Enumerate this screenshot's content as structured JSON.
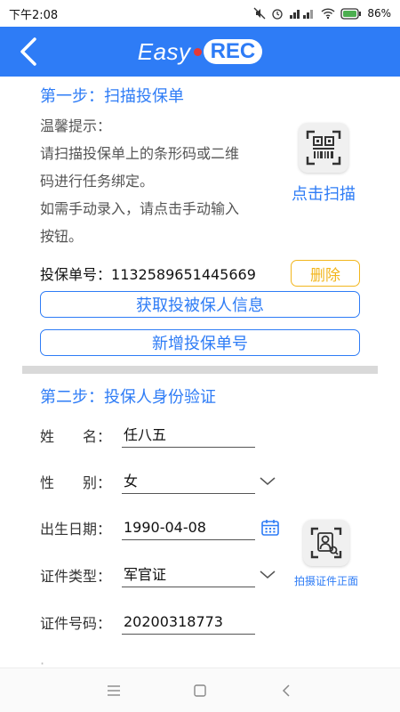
{
  "status_bar": {
    "time": "下午2:08",
    "battery": "86%"
  },
  "header": {
    "logo_left": "Easy",
    "logo_right": "REC"
  },
  "step1": {
    "title": "第一步：扫描投保单",
    "hint_lines": [
      "温馨提示：",
      "请扫描投保单上的条形码或二维",
      "码进行任务绑定。",
      "如需手动录入，请点击手动输入",
      "按钮。"
    ],
    "scan_label": "点击扫描",
    "policy_label": "投保单号：",
    "policy_number": "1132589651445669",
    "delete_label": "删除",
    "get_info_label": "获取投被保人信息",
    "add_policy_label": "新增投保单号"
  },
  "step2": {
    "title": "第二步：投保人身份验证",
    "fields": [
      {
        "label": "姓　　名：",
        "value": "任八五"
      },
      {
        "label": "性　　别：",
        "value": "女"
      },
      {
        "label": "出生日期：",
        "value": "1990-04-08"
      },
      {
        "label": "证件类型：",
        "value": "军官证"
      },
      {
        "label": "证件号码：",
        "value": "20200318773"
      }
    ],
    "id_photo_label": "拍摄证件正面"
  },
  "icons": {
    "back": "back-arrow-icon",
    "scan": "qr-scan-icon",
    "calendar": "calendar-icon",
    "dropdown": "chevron-down-icon",
    "id_photo": "id-card-person-icon"
  },
  "colors": {
    "primary": "#2e7cf6",
    "warning": "#f2b61d",
    "divider": "#d9d9d9"
  }
}
